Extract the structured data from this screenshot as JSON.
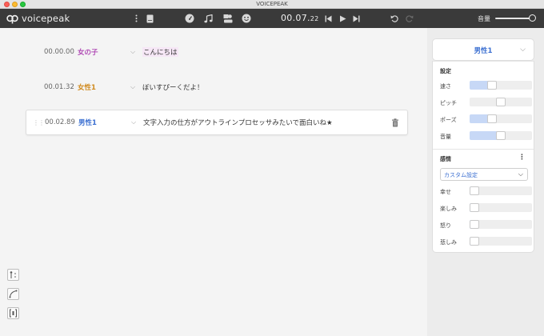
{
  "window": {
    "title": "VOICEPEAK"
  },
  "toolbar": {
    "app_name": "voicepeak",
    "time_main": "00.07.",
    "time_fraction": "22",
    "volume_label": "音量",
    "volume_level": 0.95,
    "icons": [
      "menu-kebab-icon",
      "book-icon",
      "speedometer-icon",
      "music-note-icon",
      "character-icon",
      "smiley-icon",
      "skip-back-icon",
      "play-icon",
      "skip-forward-icon",
      "undo-icon",
      "redo-icon"
    ]
  },
  "colors": {
    "toolbar_bg": "#3a3a3a",
    "accent_blue": "#3b6fd1",
    "speaker_female_child": "#b04bb5",
    "speaker_female": "#d08a1e",
    "speaker_male": "#3b6fd1",
    "slider_fill": "#c7d8f6"
  },
  "rows": [
    {
      "time": "00.00.00",
      "speaker": "女の子",
      "text": "こんにちは"
    },
    {
      "time": "00.01.32",
      "speaker": "女性1",
      "text": "ぼいすぴーくだよ！"
    },
    {
      "time": "00.02.89",
      "speaker": "男性1",
      "text": "文字入力の仕方がアウトラインプロセッサみたいで面白いね★"
    }
  ],
  "panel": {
    "voice": "男性1",
    "settings_title": "設定",
    "params": [
      {
        "label": "速さ",
        "value": 0.33
      },
      {
        "label": "ピッチ",
        "value": 0.5
      },
      {
        "label": "ポーズ",
        "value": 0.33
      },
      {
        "label": "音量",
        "value": 0.5
      }
    ],
    "emotion_title": "感情",
    "emotion_preset": "カスタム設定",
    "emotions": [
      {
        "label": "幸せ",
        "value": 0
      },
      {
        "label": "楽しみ",
        "value": 0
      },
      {
        "label": "怒り",
        "value": 0
      },
      {
        "label": "悲しみ",
        "value": 0
      }
    ]
  }
}
